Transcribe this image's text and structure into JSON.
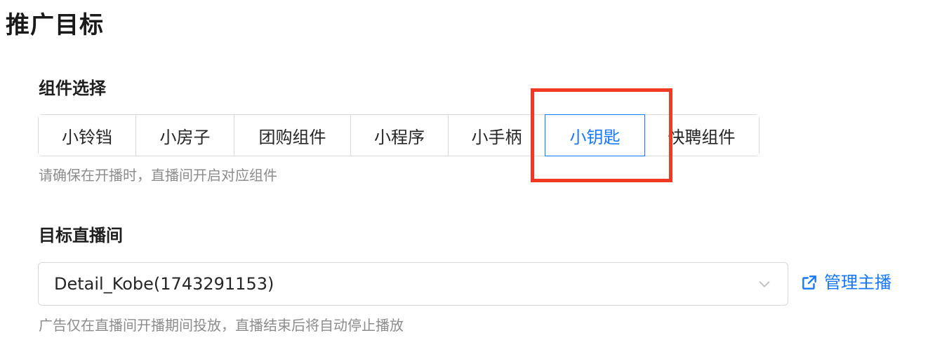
{
  "page": {
    "title": "推广目标"
  },
  "components": {
    "label": "组件选择",
    "options": [
      {
        "label": "小铃铛"
      },
      {
        "label": "小房子"
      },
      {
        "label": "团购组件"
      },
      {
        "label": "小程序"
      },
      {
        "label": "小手柄"
      },
      {
        "label": "小钥匙"
      },
      {
        "label": "快聘组件"
      }
    ],
    "selected": "小钥匙",
    "hint": "请确保在开播时，直播间开启对应组件"
  },
  "live_room": {
    "label": "目标直播间",
    "value": "Detail_Kobe(1743291153)",
    "manage_link": "管理主播",
    "hint": "广告仅在直播间开播期间投放，直播结束后将自动停止播放"
  },
  "colors": {
    "accent": "#1677ff",
    "highlight": "#f03a24",
    "border": "#d9d9d9",
    "hint": "#8c8c8c"
  },
  "icons": {
    "chevron": "chevron-down-icon",
    "external": "external-link-icon"
  }
}
